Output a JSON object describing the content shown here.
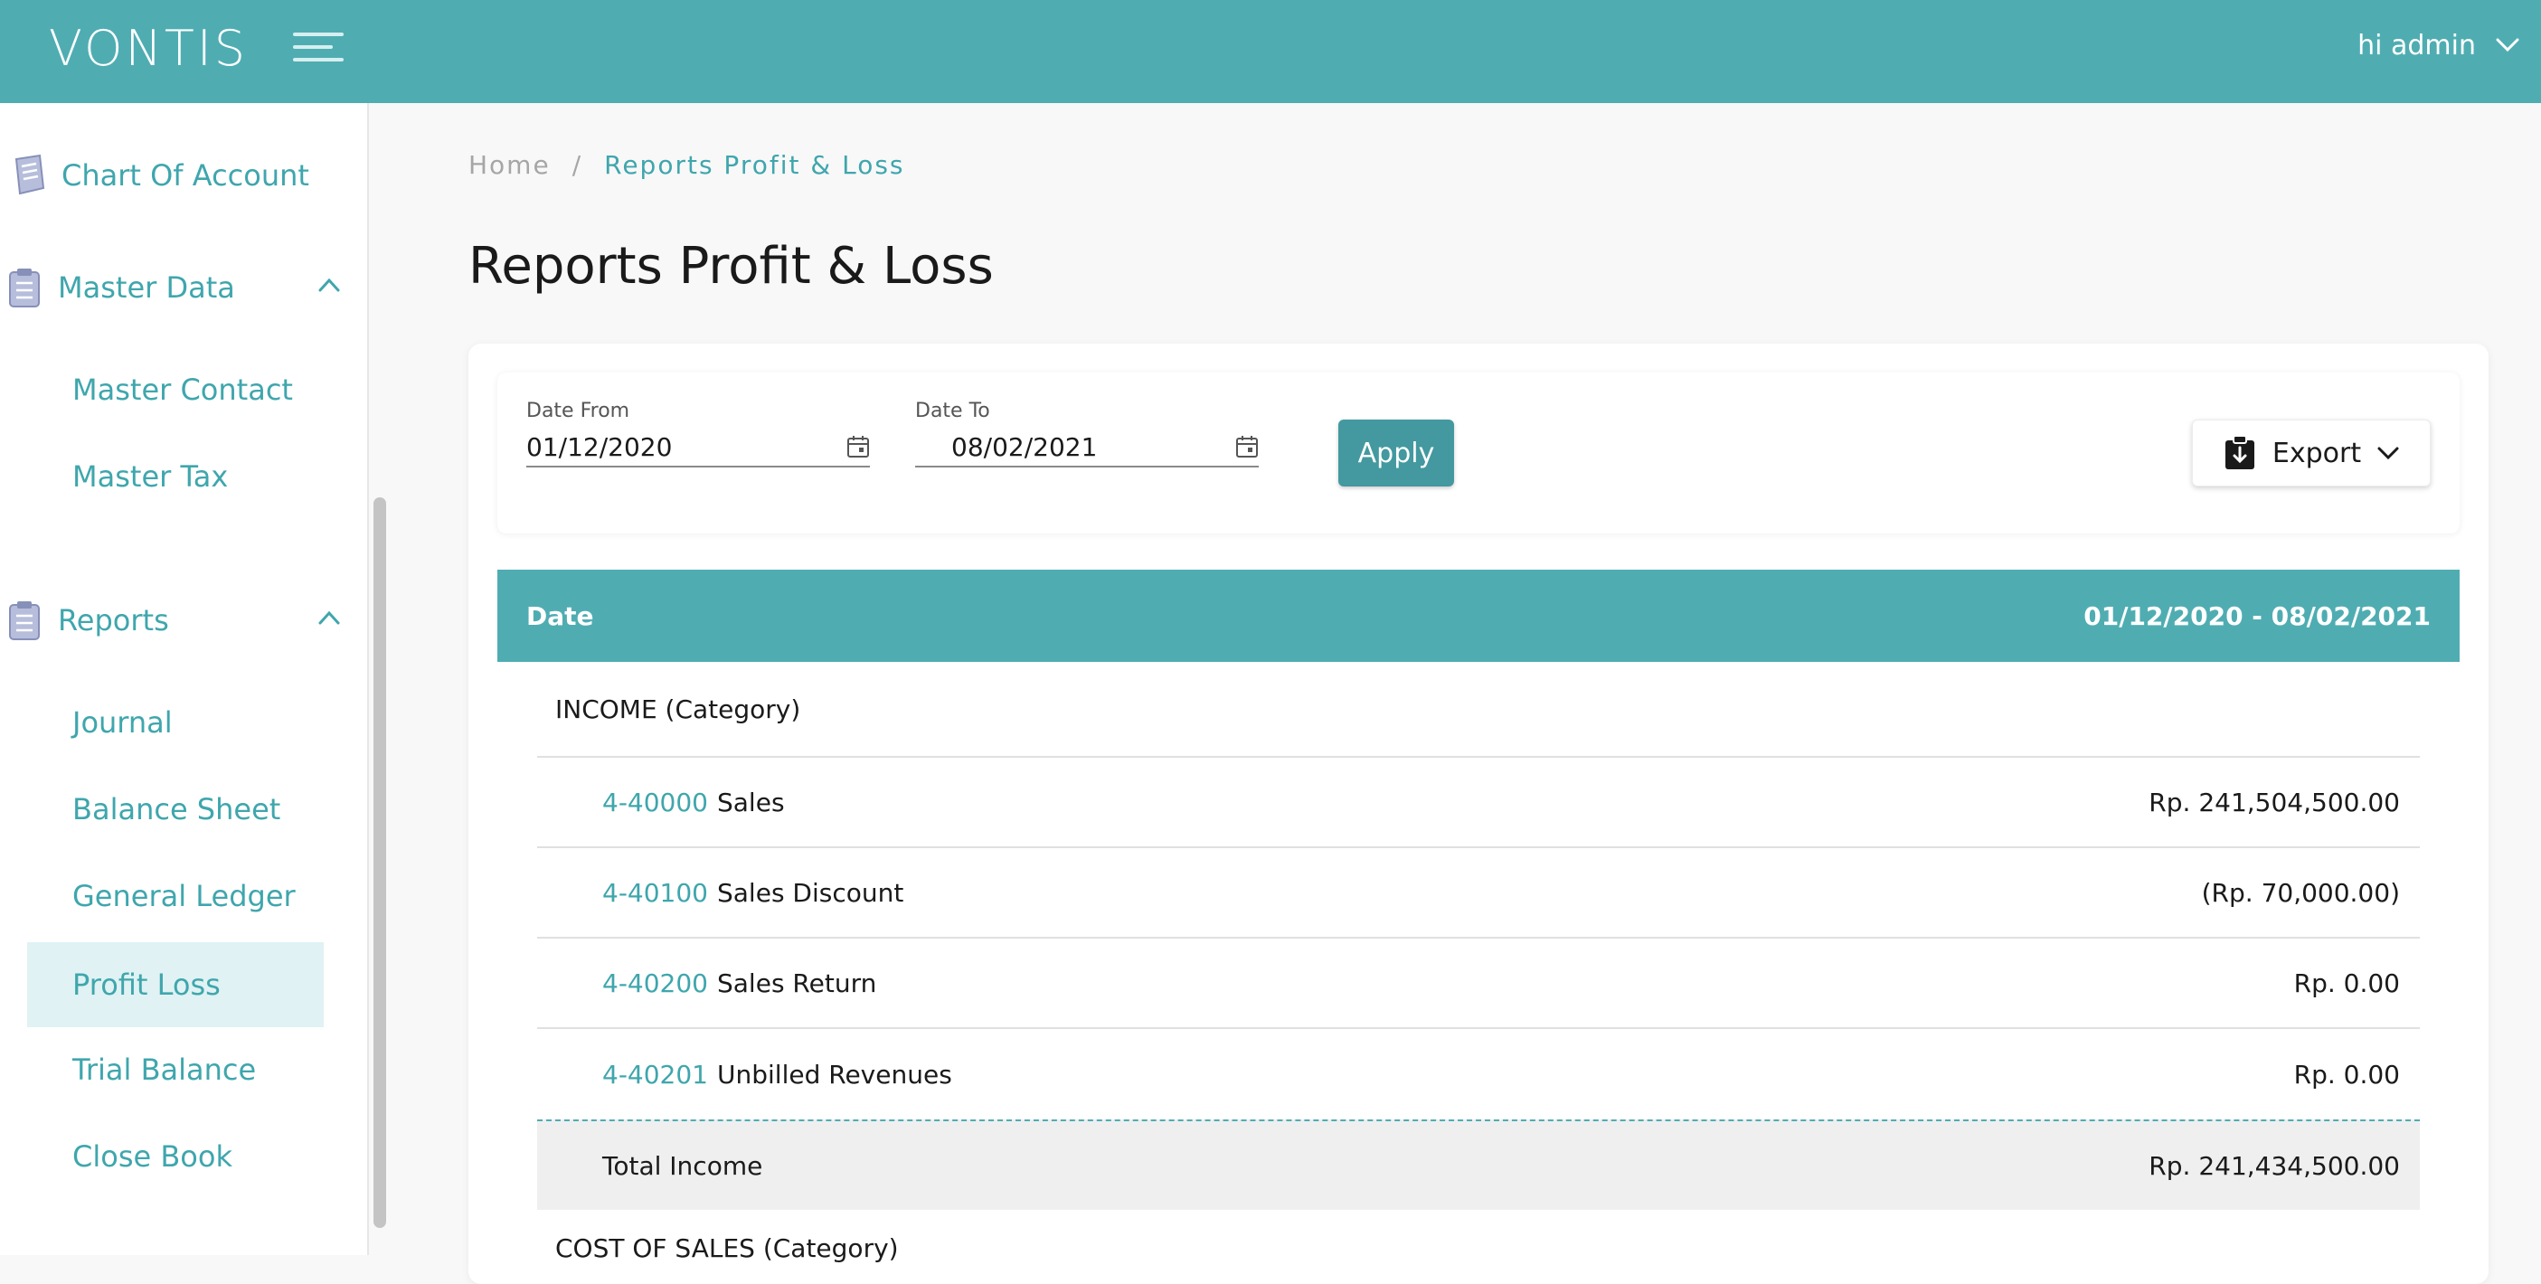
{
  "app": {
    "logo": "VONTIS",
    "user_greeting": "hi admin"
  },
  "sidebar": {
    "chart_of_account": "Chart Of Account",
    "master_data": {
      "label": "Master Data",
      "items": [
        "Master Contact",
        "Master Tax"
      ]
    },
    "reports": {
      "label": "Reports",
      "items": [
        "Journal",
        "Balance Sheet",
        "General Ledger",
        "Profit Loss",
        "Trial Balance",
        "Close Book"
      ],
      "active": "Profit Loss"
    }
  },
  "breadcrumb": {
    "home": "Home",
    "separator": "/",
    "current": "Reports Profit & Loss"
  },
  "page_title": "Reports Profit & Loss",
  "filters": {
    "date_from_label": "Date From",
    "date_from_value": "01/12/2020",
    "date_to_label": "Date To",
    "date_to_value": "08/02/2021",
    "apply_label": "Apply",
    "export_label": "Export"
  },
  "table": {
    "header_left": "Date",
    "header_right": "01/12/2020 - 08/02/2021",
    "category": "INCOME (Category)",
    "rows": [
      {
        "code": "4-40000",
        "name": "Sales",
        "amount": "Rp. 241,504,500.00"
      },
      {
        "code": "4-40100",
        "name": "Sales Discount",
        "amount": "(Rp. 70,000.00)"
      },
      {
        "code": "4-40200",
        "name": "Sales Return",
        "amount": "Rp. 0.00"
      },
      {
        "code": "4-40201",
        "name": "Unbilled Revenues",
        "amount": "Rp. 0.00"
      }
    ],
    "total_label": "Total Income",
    "total_amount": "Rp. 241,434,500.00",
    "next_category": "COST OF SALES (Category)"
  },
  "colors": {
    "primary": "#4fadb2",
    "accent_text": "#3fa6ad",
    "active_bg": "#e0f2f3"
  }
}
